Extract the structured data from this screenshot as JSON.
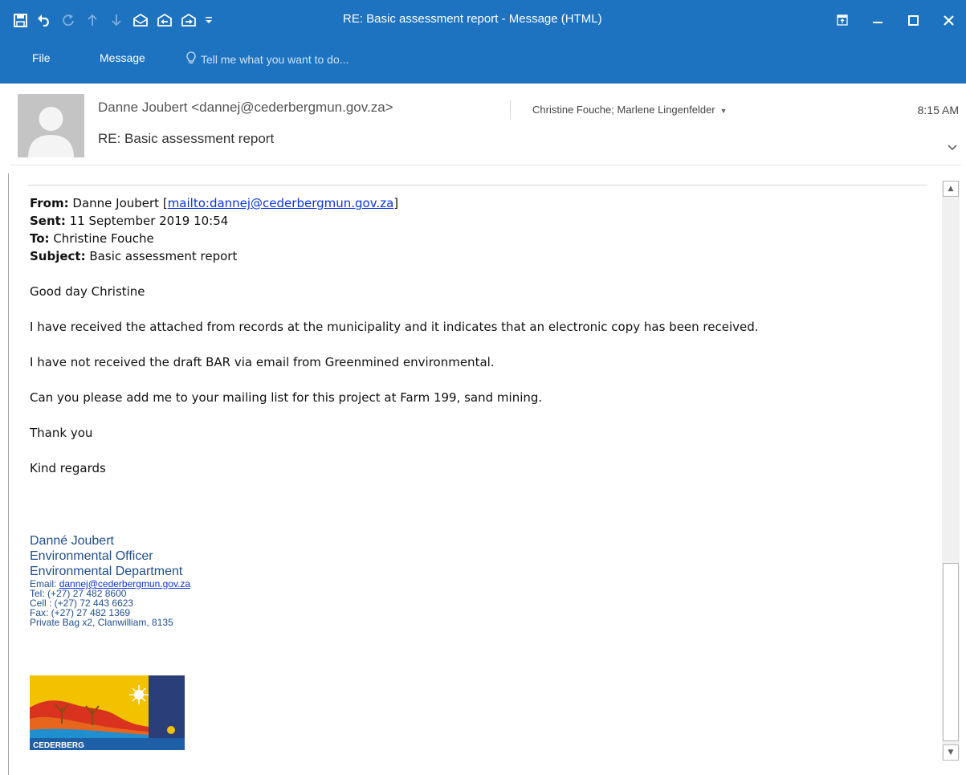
{
  "window": {
    "title": "RE: Basic assessment report - Message (HTML)"
  },
  "quick_access": {
    "items": [
      "save-icon",
      "undo-icon",
      "redo-icon",
      "previous-item-icon",
      "next-item-icon",
      "reply-icon",
      "reply-all-icon",
      "forward-icon",
      "customize-toolbar-icon"
    ]
  },
  "ribbon": {
    "tabs": [
      {
        "label": "File"
      },
      {
        "label": "Message"
      }
    ],
    "tell_me": "Tell me what you want to do..."
  },
  "header": {
    "sender": "Danne Joubert <dannej@cederbergmun.gov.za>",
    "recipients": "Christine Fouche; Marlene Lingenfelder",
    "time": "8:15 AM",
    "subject": "RE: Basic assessment report"
  },
  "message": {
    "from_label": "From:",
    "from_name": "Danne Joubert [",
    "from_link": "mailto:dannej@cederbergmun.gov.za",
    "from_close": "]",
    "sent_label": "Sent:",
    "sent_value": "11 September 2019 10:54",
    "to_label": "To:",
    "to_value": "Christine Fouche",
    "subject_label": "Subject:",
    "subject_value": "Basic assessment report",
    "greeting": "Good day Christine",
    "paragraphs": [
      "I have received the attached from records at the municipality and it indicates that an electronic copy has been received.",
      "I have not received the draft BAR via email from Greenmined environmental.",
      "Can you please add me to your mailing list for this project at Farm 199, sand mining.",
      "Thank you",
      "Kind regards"
    ]
  },
  "signature": {
    "name": "Danné Joubert",
    "title": "Environmental Officer",
    "department": "Environmental Department",
    "email_label": "Email: ",
    "email": "dannej@cederbergmun.gov.za",
    "tel": "Tel: (+27) 27 482 8600",
    "cell": "Cell : (+27) 72 443 6623",
    "fax": "Fax: (+27) 27 482 1369",
    "address": "Private Bag x2, Clanwilliam, 8135",
    "logo_text": "CEDERBERG"
  },
  "colors": {
    "title_bar": "#1e73c0",
    "signature_text": "#1f4e8f",
    "link": "#0b32e8"
  }
}
